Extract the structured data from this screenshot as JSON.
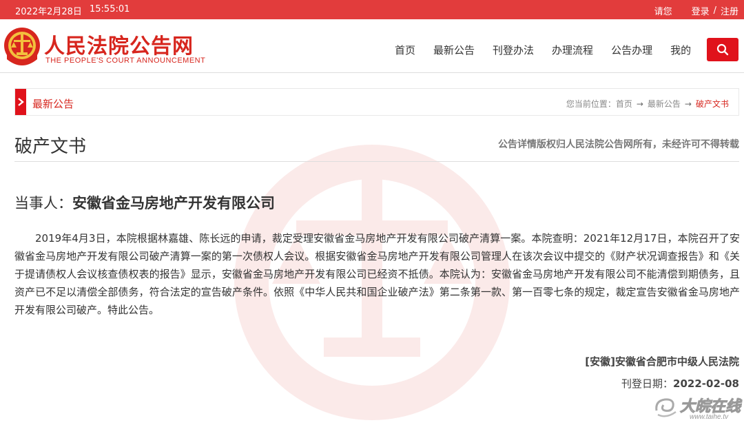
{
  "topbar": {
    "date": "2022年2月28日",
    "time": "15:55:01",
    "login_prompt": "请您",
    "login": "登录",
    "sep": "/",
    "register": "注册"
  },
  "header": {
    "logo_cn": "人民法院公告网",
    "logo_en": "THE PEOPLE'S COURT ANNOUNCEMENT",
    "nav": [
      "首页",
      "最新公告",
      "刊登办法",
      "办理流程",
      "公告办理",
      "我的"
    ]
  },
  "section": {
    "title": "最新公告",
    "breadcrumb_prefix": "您当前位置：",
    "crumbs": [
      "首页",
      "最新公告",
      "破产文书"
    ]
  },
  "doc": {
    "title": "破产文书",
    "copyright": "公告详情版权归人民法院公告网所有，未经许可不得转载",
    "party_label": "当事人：",
    "party_name": "安徽省金马房地产开发有限公司",
    "content": "2019年4月3日，本院根据林嘉雄、陈长远的申请，裁定受理安徽省金马房地产开发有限公司破产清算一案。本院查明：2021年12月17日，本院召开了安徽省金马房地产开发有限公司破产清算一案的第一次债权人会议。根据安徽省金马房地产开发有限公司管理人在该次会议中提交的《财产状况调查报告》和《关于提请债权人会议核查债权表的报告》显示，安徽省金马房地产开发有限公司已经资不抵债。本院认为：安徽省金马房地产开发有限公司不能清偿到期债务，且资产已不足以清偿全部债务，符合法定的宣告破产条件。依照《中华人民共和国企业破产法》第二条第一款、第一百零七条的规定，裁定宣告安徽省金马房地产开发有限公司破产。特此公告。",
    "court": "[安徽]安徽省合肥市中级人民法院",
    "pubdate_label": "刊登日期：",
    "pubdate": "2022-02-08"
  },
  "site_mark": {
    "name": "大皖在线",
    "url": "www.taihe.tv"
  },
  "colors": {
    "brand_red": "#e0121b",
    "topbar_red": "#e23c3c"
  }
}
